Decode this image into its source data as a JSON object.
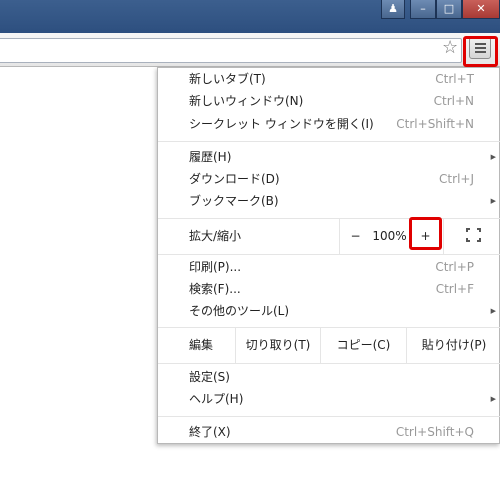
{
  "window": {
    "buttons": {
      "user": "♟",
      "minimize": "–",
      "maximize": "□",
      "close": "✕"
    }
  },
  "toolbar": {
    "star_icon": "star-icon",
    "menu_icon": "hamburger-icon"
  },
  "menu": {
    "group1": [
      {
        "label": "新しいタブ(T)",
        "shortcut": "Ctrl+T"
      },
      {
        "label": "新しいウィンドウ(N)",
        "shortcut": "Ctrl+N"
      },
      {
        "label": "シークレット ウィンドウを開く(I)",
        "shortcut": "Ctrl+Shift+N"
      }
    ],
    "group2": [
      {
        "label": "履歴(H)",
        "shortcut": ""
      },
      {
        "label": "ダウンロード(D)",
        "shortcut": "Ctrl+J"
      },
      {
        "label": "ブックマーク(B)",
        "shortcut": ""
      }
    ],
    "zoom": {
      "label": "拡大/縮小",
      "minus": "−",
      "value": "100%",
      "plus": "+"
    },
    "group3": [
      {
        "label": "印刷(P)...",
        "shortcut": "Ctrl+P"
      },
      {
        "label": "検索(F)...",
        "shortcut": "Ctrl+F"
      },
      {
        "label": "その他のツール(L)",
        "shortcut": ""
      }
    ],
    "edit": {
      "label": "編集",
      "cut": "切り取り(T)",
      "copy": "コピー(C)",
      "paste": "貼り付け(P)"
    },
    "group4": [
      {
        "label": "設定(S)",
        "shortcut": ""
      },
      {
        "label": "ヘルプ(H)",
        "shortcut": ""
      }
    ],
    "exit": {
      "label": "終了(X)",
      "shortcut": "Ctrl+Shift+Q"
    }
  },
  "colors": {
    "highlight": "#e00000",
    "titlebar": "#2d4f7f"
  }
}
